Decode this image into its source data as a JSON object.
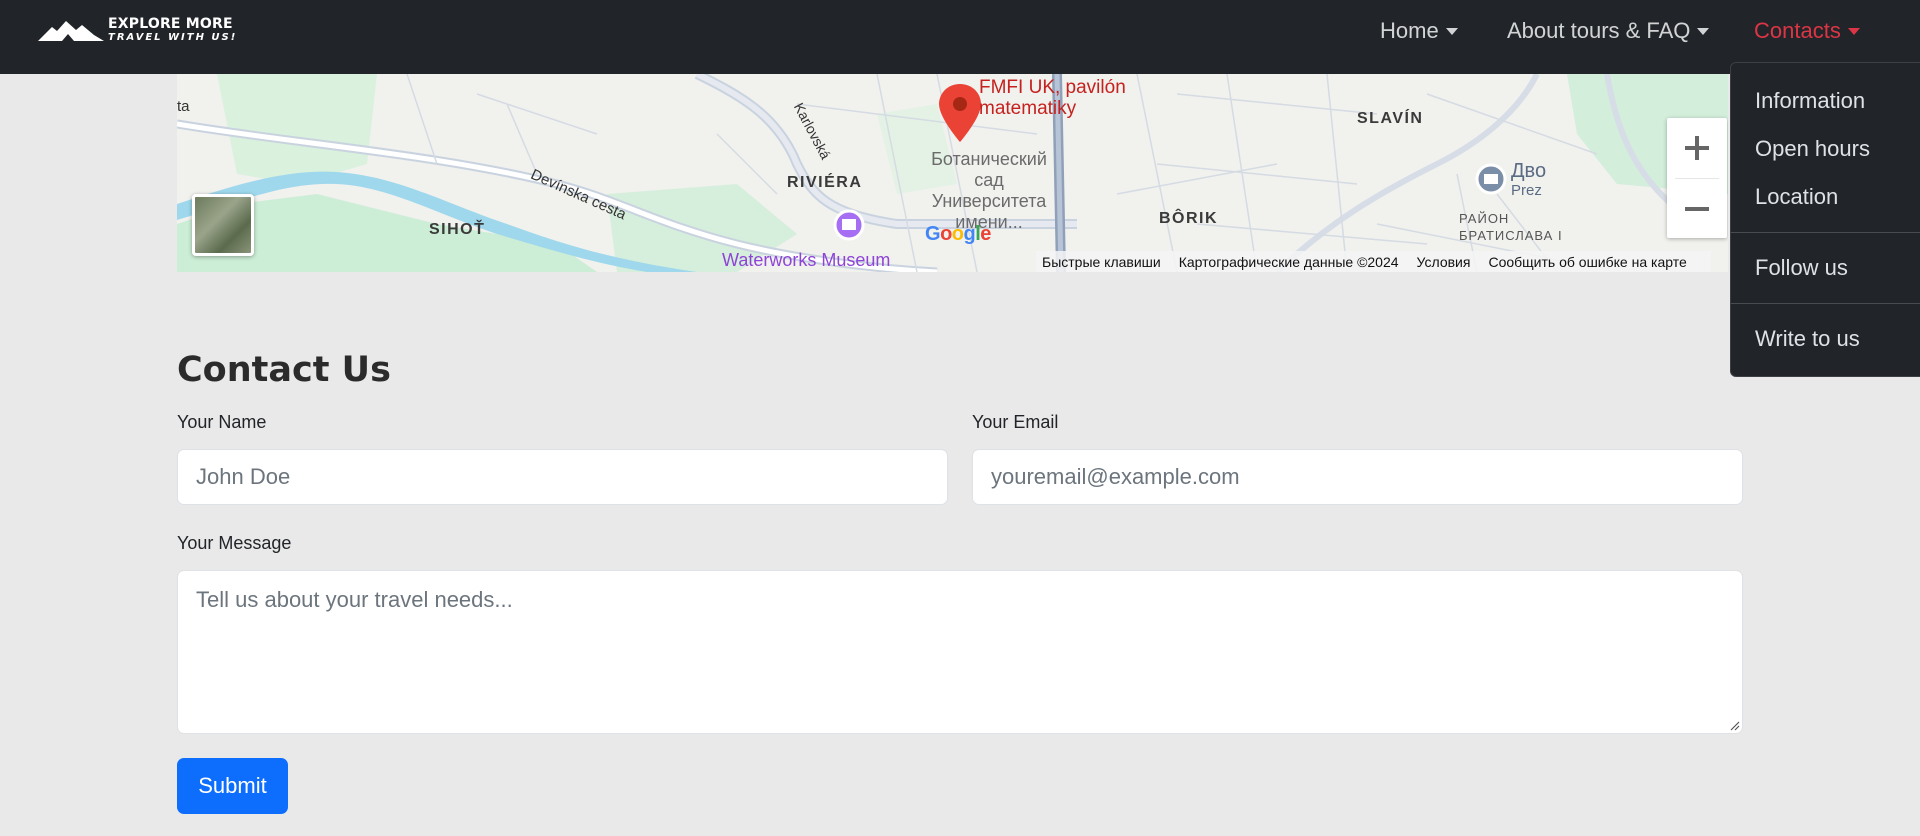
{
  "brand": {
    "line1": "EXPLORE MORE",
    "line2": "TRAVEL WITH US!"
  },
  "nav": {
    "home": "Home",
    "about": "About tours & FAQ",
    "contacts": "Contacts"
  },
  "colors": {
    "navbar": "#212529",
    "accent": "#dc3545",
    "primary": "#0d6efd",
    "page": "#e9e9e9"
  },
  "dropdown": {
    "items": [
      "Information",
      "Open hours",
      "Location",
      "Follow us",
      "Write to us"
    ]
  },
  "map": {
    "pin_label_1": "FMFI UK, pavilón",
    "pin_label_2": "matematiky",
    "districts": [
      "SLAVÍN",
      "RIVIÉRA",
      "SIHOŤ",
      "BÔRIK"
    ],
    "streets": [
      "Karlovská",
      "Devínska cesta",
      "ta"
    ],
    "poi": {
      "botanic_1": "Ботанический",
      "botanic_2": "сад",
      "botanic_3": "Университета",
      "botanic_4": "имени...",
      "museum": "Waterworks Museum",
      "dvo": "Дво",
      "prez": "Prez",
      "raion_1": "РАЙОН",
      "raion_2": "БРАТИСЛАВА I"
    },
    "google": "Google",
    "attribution": {
      "shortcuts": "Быстрые клавиши",
      "data": "Картографические данные ©2024",
      "terms": "Условия",
      "report": "Сообщить об ошибке на карте"
    },
    "zoom_in": "+",
    "zoom_out": "−"
  },
  "contact": {
    "title": "Contact Us",
    "name_label": "Your Name",
    "name_placeholder": "John Doe",
    "email_label": "Your Email",
    "email_placeholder": "youremail@example.com",
    "message_label": "Your Message",
    "message_placeholder": "Tell us about your travel needs...",
    "submit": "Submit"
  }
}
